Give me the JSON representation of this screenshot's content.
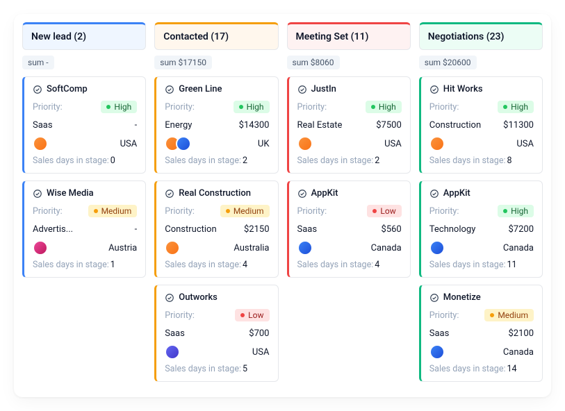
{
  "labels": {
    "priority": "Priority:",
    "stage": "Sales days in stage:",
    "sum_prefix": "sum"
  },
  "priority_levels": {
    "high": "High",
    "medium": "Medium",
    "low": "Low"
  },
  "columns": [
    {
      "id": "new-lead",
      "title": "New lead (2)",
      "color": "blue",
      "sum": "-",
      "cards": [
        {
          "name": "SoftComp",
          "priority": "high",
          "industry": "Saas",
          "amount": "-",
          "avatars": [
            "a1"
          ],
          "country": "USA",
          "stage_days": "0"
        },
        {
          "name": "Wise Media",
          "priority": "medium",
          "industry": "Advertis...",
          "amount": "-",
          "avatars": [
            "a3"
          ],
          "country": "Austria",
          "stage_days": "1"
        }
      ]
    },
    {
      "id": "contacted",
      "title": "Contacted (17)",
      "color": "orange",
      "sum": "$17150",
      "cards": [
        {
          "name": "Green Line",
          "priority": "high",
          "industry": "Energy",
          "amount": "$14300",
          "avatars": [
            "a1",
            "a2"
          ],
          "country": "UK",
          "stage_days": "2"
        },
        {
          "name": "Real Construction",
          "priority": "medium",
          "industry": "Construction",
          "amount": "$2150",
          "avatars": [
            "a1"
          ],
          "country": "Australia",
          "stage_days": "4"
        },
        {
          "name": "Outworks",
          "priority": "low",
          "industry": "Saas",
          "amount": "$700",
          "avatars": [
            "a4"
          ],
          "country": "USA",
          "stage_days": "5"
        }
      ]
    },
    {
      "id": "meeting-set",
      "title": "Meeting Set (11)",
      "color": "red",
      "sum": "$8060",
      "cards": [
        {
          "name": "JustIn",
          "priority": "high",
          "industry": "Real Estate",
          "amount": "$7500",
          "avatars": [
            "a1"
          ],
          "country": "USA",
          "stage_days": "2"
        },
        {
          "name": "AppKit",
          "priority": "low",
          "industry": "Saas",
          "amount": "$560",
          "avatars": [
            "a2"
          ],
          "country": "Canada",
          "stage_days": "4"
        }
      ]
    },
    {
      "id": "negotiations",
      "title": "Negotiations (23)",
      "color": "green",
      "sum": "$20600",
      "cards": [
        {
          "name": "Hit Works",
          "priority": "high",
          "industry": "Construction",
          "amount": "$11300",
          "avatars": [
            "a1"
          ],
          "country": "USA",
          "stage_days": "8"
        },
        {
          "name": "AppKit",
          "priority": "high",
          "industry": "Technology",
          "amount": "$7200",
          "avatars": [
            "a2"
          ],
          "country": "Canada",
          "stage_days": "11"
        },
        {
          "name": "Monetize",
          "priority": "medium",
          "industry": "Saas",
          "amount": "$2100",
          "avatars": [
            "a2"
          ],
          "country": "Canada",
          "stage_days": "14"
        }
      ]
    }
  ]
}
